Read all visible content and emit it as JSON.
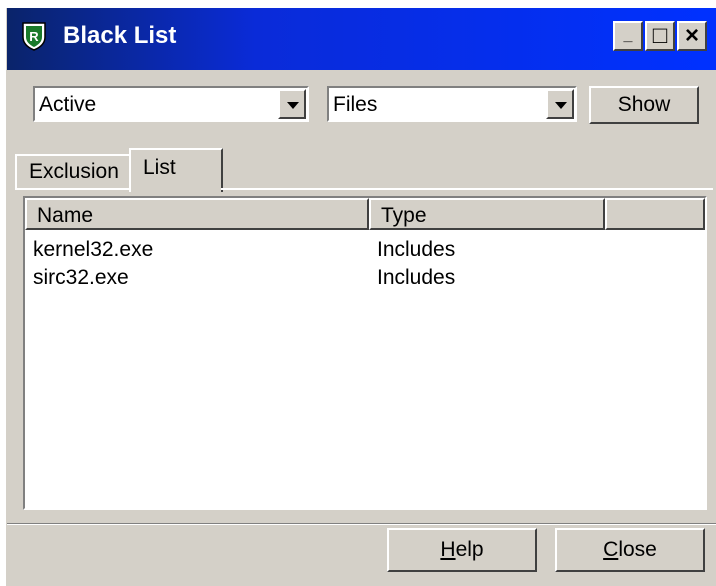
{
  "window": {
    "title": "Black List",
    "icon": "shield-r-icon",
    "title_bar_color": "#0031ff"
  },
  "titlebar_buttons": {
    "minimize": "_",
    "maximize": "□",
    "close": "×"
  },
  "filters": {
    "status_select": {
      "value": "Active"
    },
    "type_select": {
      "value": "Files"
    },
    "show_label": "Show"
  },
  "tabs": [
    {
      "label": "Exclusion",
      "active": false
    },
    {
      "label": "List",
      "active": true
    }
  ],
  "table": {
    "columns": [
      "Name",
      "Type",
      ""
    ],
    "rows": [
      {
        "name": "kernel32.exe",
        "type": "Includes"
      },
      {
        "name": "sirc32.exe",
        "type": "Includes"
      }
    ]
  },
  "footer": {
    "help_accel": "H",
    "help_rest": "elp",
    "close_accel": "C",
    "close_rest": "lose"
  }
}
